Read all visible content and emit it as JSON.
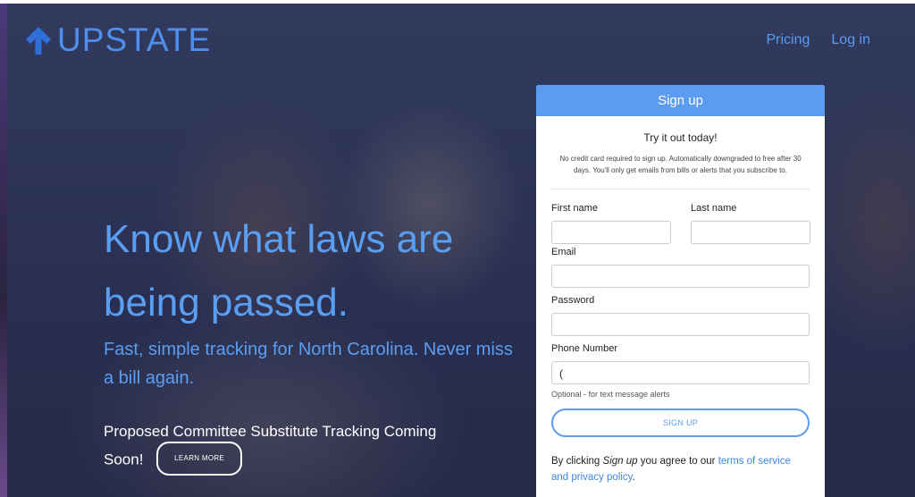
{
  "brand": {
    "name": "UPSTATE",
    "logo_icon": "arrow-up-icon",
    "color": "#4f8ff0"
  },
  "nav": {
    "pricing": "Pricing",
    "login": "Log in"
  },
  "hero": {
    "headline": "Know what laws are being passed.",
    "subline": "Fast, simple tracking for North Carolina. Never miss a bill again.",
    "promo": "Proposed Committee Substitute Tracking Coming Soon!",
    "learn_more": "LEARN MORE"
  },
  "signup": {
    "title": "Sign up",
    "tagline": "Try it out today!",
    "notice": "No credit card required to sign up. Automatically downgraded to free after 30 days. You'll only get emails from bills or alerts that you subscribe to.",
    "first_name_label": "First name",
    "last_name_label": "Last name",
    "email_label": "Email",
    "password_label": "Password",
    "phone_label": "Phone Number",
    "phone_value": "(",
    "phone_hint": "Optional - for text message alerts",
    "button": "SIGN UP",
    "terms_prefix": "By clicking ",
    "terms_em": "Sign up",
    "terms_middle": " you agree to our ",
    "terms_link": "terms of service and privacy policy",
    "terms_suffix": "."
  },
  "colors": {
    "accent": "#5b9cf0",
    "text_blue": "#5a9ef2"
  }
}
